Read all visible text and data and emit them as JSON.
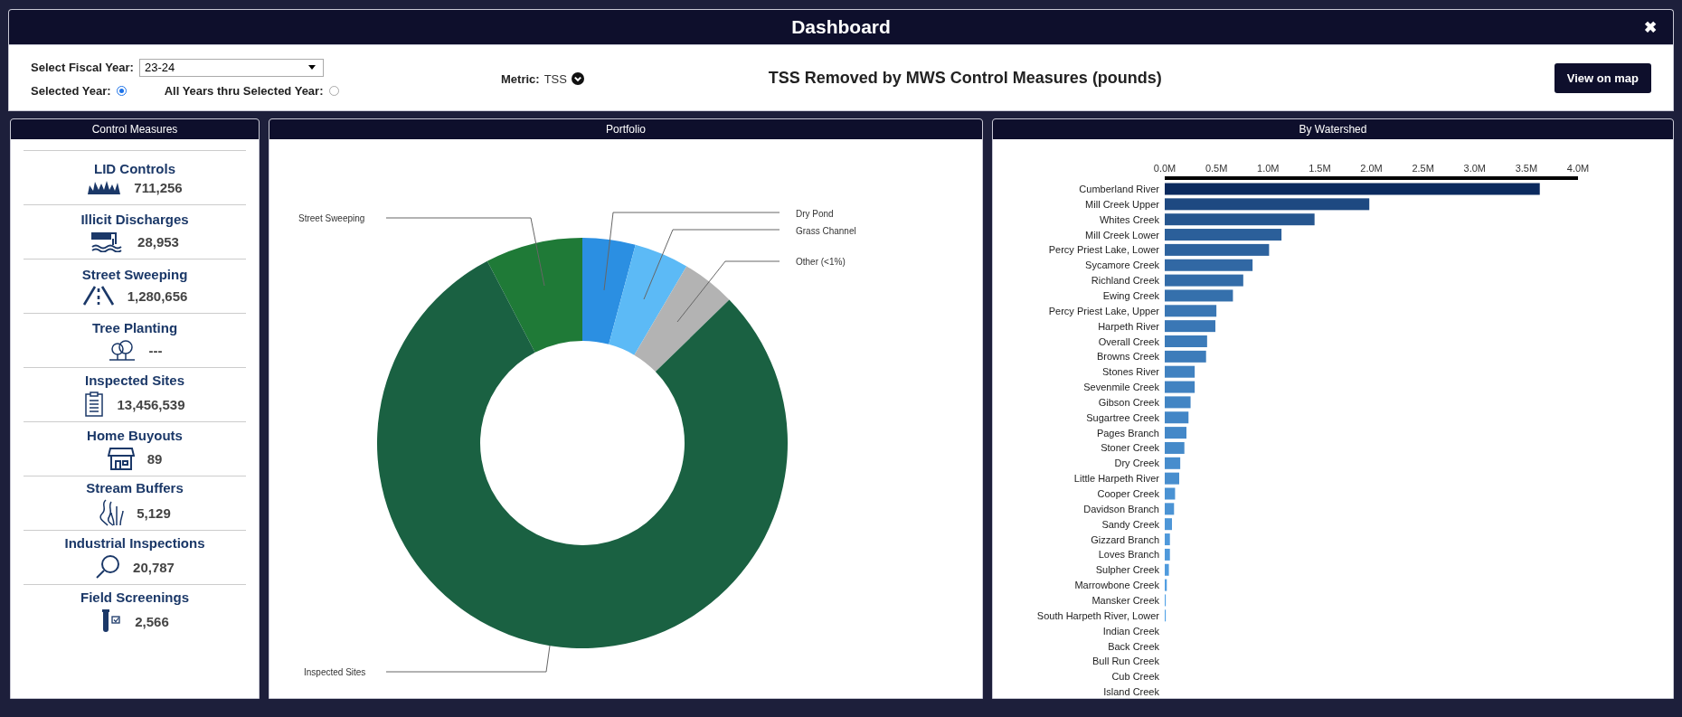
{
  "window": {
    "title": "Dashboard",
    "close": "✖"
  },
  "filters": {
    "fiscal_year_label": "Select Fiscal Year:",
    "fiscal_year": "23-24",
    "modes": [
      {
        "label": "Selected Year:",
        "selected": true
      },
      {
        "label": "All Years thru Selected Year:",
        "selected": false
      }
    ],
    "metric_label": "Metric:",
    "metric": "TSS"
  },
  "heading": "TSS Removed by MWS Control Measures (pounds)",
  "view_button": "View on map",
  "control_measures": {
    "title": "Control Measures",
    "items": [
      {
        "name": "LID Controls",
        "value": "711,256"
      },
      {
        "name": "Illicit Discharges",
        "value": "28,953"
      },
      {
        "name": "Street Sweeping",
        "value": "1,280,656"
      },
      {
        "name": "Tree Planting",
        "value": "---"
      },
      {
        "name": "Inspected Sites",
        "value": "13,456,539"
      },
      {
        "name": "Home Buyouts",
        "value": "89"
      },
      {
        "name": "Stream Buffers",
        "value": "5,129"
      },
      {
        "name": "Industrial Inspections",
        "value": "20,787"
      },
      {
        "name": "Field Screenings",
        "value": "2,566"
      }
    ]
  },
  "portfolio": {
    "title": "Portfolio",
    "slices": [
      {
        "label": "Street Sweeping",
        "color": "#1f7a37"
      },
      {
        "label": "Dry Pond",
        "color": "#2b8fe2"
      },
      {
        "label": "Grass Channel",
        "color": "#5cbaf6"
      },
      {
        "label": "Other (<1%)",
        "color": "#b3b3b3"
      },
      {
        "label": "Inspected Sites",
        "color": "#1a6142"
      }
    ]
  },
  "watershed": {
    "title": "By Watershed",
    "chart_data": {
      "type": "bar",
      "orientation": "horizontal",
      "categories": [
        "Cumberland River",
        "Mill Creek Upper",
        "Whites Creek",
        "Mill Creek Lower",
        "Percy Priest Lake, Lower",
        "Sycamore Creek",
        "Richland Creek",
        "Ewing Creek",
        "Percy Priest Lake, Upper",
        "Harpeth River",
        "Overall Creek",
        "Browns Creek",
        "Stones River",
        "Sevenmile Creek",
        "Gibson Creek",
        "Sugartree Creek",
        "Pages Branch",
        "Stoner Creek",
        "Dry Creek",
        "Little Harpeth River",
        "Cooper Creek",
        "Davidson Branch",
        "Sandy Creek",
        "Gizzard Branch",
        "Loves Branch",
        "Sulpher Creek",
        "Marrowbone Creek",
        "Mansker Creek",
        "South Harpeth River, Lower",
        "Indian Creek",
        "Back Creek",
        "Bull Run Creek",
        "Cub Creek",
        "Island Creek"
      ],
      "series": [
        {
          "values": [
            3630000,
            1980000,
            1450000,
            1130000,
            1010000,
            850000,
            760000,
            660000,
            500000,
            490000,
            410000,
            400000,
            290000,
            290000,
            250000,
            230000,
            210000,
            190000,
            150000,
            140000,
            100000,
            90000,
            70000,
            50000,
            50000,
            40000,
            20000,
            10000,
            10000,
            0,
            0,
            0,
            0,
            0
          ]
        }
      ],
      "xlim": [
        0,
        4000000
      ],
      "xticks": [
        {
          "value": 0,
          "label": "0.0M"
        },
        {
          "value": 500000,
          "label": "0.5M"
        },
        {
          "value": 1000000,
          "label": "1.0M"
        },
        {
          "value": 1500000,
          "label": "1.5M"
        },
        {
          "value": 2000000,
          "label": "2.0M"
        },
        {
          "value": 2500000,
          "label": "2.5M"
        },
        {
          "value": 3000000,
          "label": "3.0M"
        },
        {
          "value": 3500000,
          "label": "3.5M"
        },
        {
          "value": 4000000,
          "label": "4.0M"
        }
      ]
    }
  }
}
